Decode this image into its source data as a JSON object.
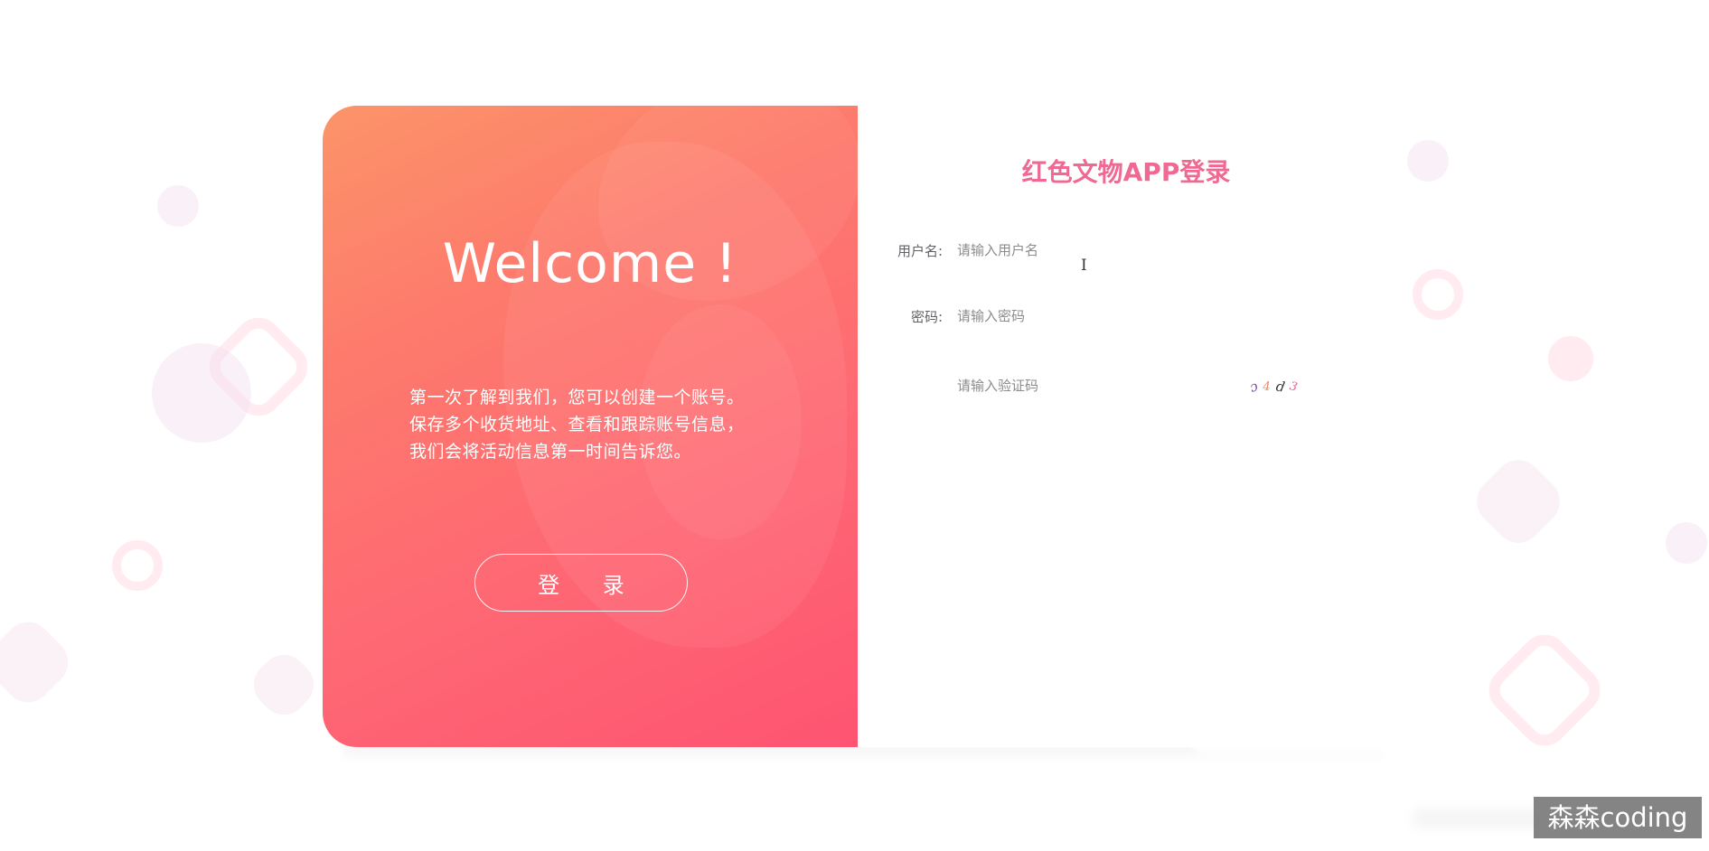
{
  "colors": {
    "accent": "#ef6992",
    "gradient_start": "#fc9469",
    "gradient_end": "#fe5472"
  },
  "left_panel": {
    "welcome": "Welcome !",
    "intro_lines": [
      "第一次了解到我们，您可以创建一个账号。",
      "保存多个收货地址、查看和跟踪账号信息，",
      "我们会将活动信息第一时间告诉您。"
    ],
    "login_button": "登 录"
  },
  "form": {
    "title": "红色文物APP登录",
    "username": {
      "label": "用户名:",
      "placeholder": "请输入用户名"
    },
    "password": {
      "label": "密码:",
      "placeholder": "请输入密码"
    },
    "captcha_input": {
      "placeholder": "请输入验证码"
    },
    "captcha_chars": [
      {
        "char": "ɔ",
        "color": "#7b4bb3"
      },
      {
        "char": "4",
        "color": "#f08a5d"
      },
      {
        "char": "d",
        "color": "#333333"
      },
      {
        "char": "3",
        "color": "#e8608a"
      }
    ]
  },
  "watermark": "森森coding"
}
